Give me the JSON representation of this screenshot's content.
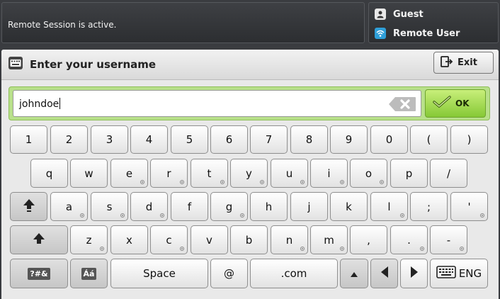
{
  "status": {
    "message": "Remote Session is active.",
    "users": [
      {
        "label": "Guest",
        "icon": "user-icon"
      },
      {
        "label": "Remote User",
        "icon": "wifi-icon"
      }
    ]
  },
  "header": {
    "title": "Enter your username",
    "exit_label": "Exit"
  },
  "input": {
    "value": "johndoe",
    "ok_label": "OK"
  },
  "keyboard": {
    "row1": [
      "1",
      "2",
      "3",
      "4",
      "5",
      "6",
      "7",
      "8",
      "9",
      "0",
      "(",
      ")"
    ],
    "row2": [
      "q",
      "w",
      "e",
      "r",
      "t",
      "y",
      "u",
      "i",
      "o",
      "p",
      "/"
    ],
    "row3": [
      "a",
      "s",
      "d",
      "f",
      "g",
      "h",
      "j",
      "k",
      "l",
      ";",
      "'"
    ],
    "row4": [
      "z",
      "x",
      "c",
      "v",
      "b",
      "n",
      "m",
      ",",
      ".",
      "-"
    ],
    "symbols_label": "?#&",
    "accents_label": "Áá",
    "space_label": "Space",
    "at_label": "@",
    "dotcom_label": ".com",
    "language_label": "ENG"
  },
  "colors": {
    "accent_green": "#b8e08a",
    "ok_green": "#86c936",
    "status_bg": "#2c2e31"
  }
}
